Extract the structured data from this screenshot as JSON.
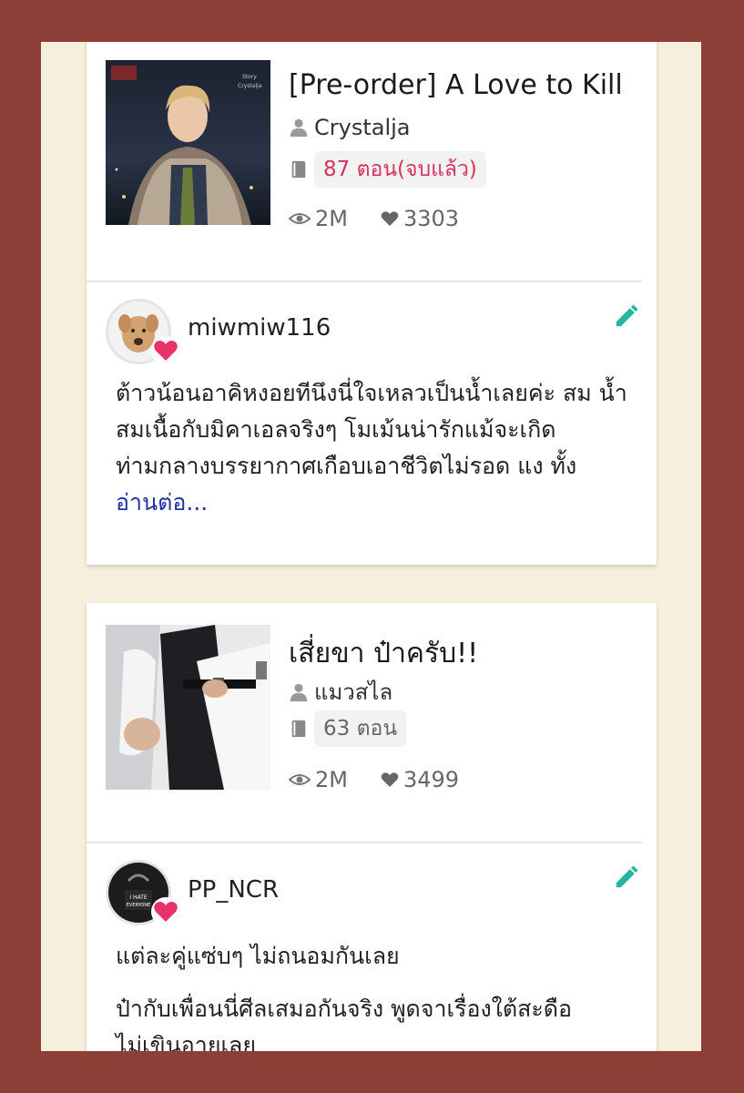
{
  "items": [
    {
      "title": "[Pre-order] A Love to Kill",
      "author": "Crystalja",
      "chapters": "87 ตอน(จบแล้ว)",
      "views": "2M",
      "likes": "3303",
      "cover_alt": "Story Crystalja",
      "review": {
        "username": "miwmiw116",
        "text": "ต้าวน้อนอาคิหงอยทีนึงนี่ใจเหลวเป็นน้ำเลยค่ะ สม น้ำสมเนื้อกับมิคาเอลจริงๆ โมเม้นน่ารักแม้จะเกิด ท่ามกลางบรรยากาศเกือบเอาชีวิตไม่รอด แง ทั้ง",
        "read_more": "อ่านต่อ..."
      }
    },
    {
      "title": "เสี่ยขา ป๋าครับ!!",
      "author": "แมวสไล",
      "chapters": "63 ตอน",
      "views": "2M",
      "likes": "3499",
      "review": {
        "username": "PP_NCR",
        "avatar_text": "I HATE EVERYONE",
        "line1": "แต่ละคู่แซ่บๆ  ไม่ถนอมกันเลย",
        "line2": "ป๋ากับเพื่อนนี่ศีลเสมอกันจริง พูดจาเรื่องใต้สะดือ",
        "line3": "ไม่เขินอายเลย"
      }
    }
  ],
  "colors": {
    "frame": "#8c3e37",
    "paper": "#f6efdd",
    "accent_pink": "#d6335c",
    "edit_teal": "#26b5a0",
    "link_blue": "#1f2fa8"
  },
  "icons": [
    "user-icon",
    "book-icon",
    "eye-icon",
    "heart-icon",
    "edit-pencil-icon",
    "heart-badge-icon"
  ]
}
